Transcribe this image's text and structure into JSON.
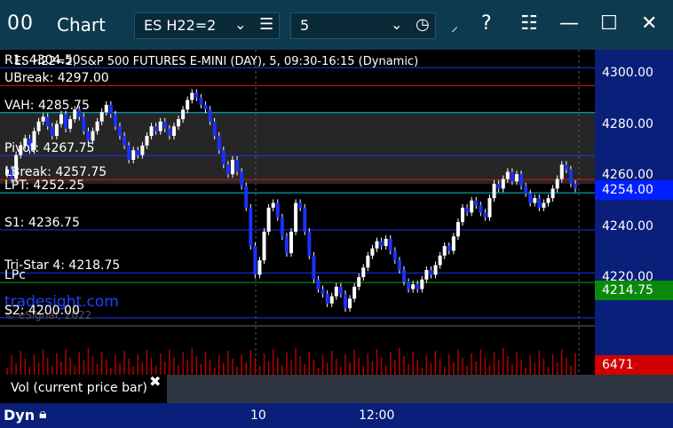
{
  "window": {
    "title": "Chart",
    "layout_icon": "00",
    "symbol": "ES H22=2",
    "interval": "5"
  },
  "chart": {
    "header": "ES H22=2, S&P 500 FUTURES E-MINI (DAY), 5, 09:30-16:15 (Dynamic)",
    "watermark": "tradesight.com",
    "copyright": "© eSignal, 2022",
    "levels": [
      {
        "label": "R1: 4304.50",
        "price": 4304.5,
        "color": "#2030ff"
      },
      {
        "label": "UBreak: 4297.00",
        "price": 4297.0,
        "color": "#e01010"
      },
      {
        "label": "VAH: 4285.75",
        "price": 4285.75,
        "color": "#00c8d8"
      },
      {
        "label": "Pivot: 4267.75",
        "price": 4267.75,
        "color": "#2030ff"
      },
      {
        "label": "LBreak: 4257.75",
        "price": 4257.75,
        "color": "#e01010"
      },
      {
        "label": "LPT: 4252.25",
        "price": 4252.25,
        "color": "#00c8d8"
      },
      {
        "label": "S1: 4236.75",
        "price": 4236.75,
        "color": "#2030ff"
      },
      {
        "label": "Tri-Star 4: 4218.75",
        "price": 4218.75,
        "color": "#2030ff"
      },
      {
        "label": "LPc",
        "price": 4214.75,
        "color": "#10a010"
      },
      {
        "label": "S2: 4200.00",
        "price": 4200.0,
        "color": "#2030ff"
      }
    ]
  },
  "axis": {
    "ticks": [
      "4300.00",
      "4280.00",
      "4260.00",
      "4240.00",
      "4220.00"
    ],
    "current_price": "4254.00",
    "lpc_price": "4214.75",
    "volume": "6471"
  },
  "vol_panel": {
    "label": "Vol (current price bar)"
  },
  "bottom": {
    "dyn": "Dyn",
    "x_labels": [
      "10",
      "12:00"
    ]
  },
  "chart_data": {
    "type": "candlestick",
    "ylim": [
      4197,
      4312
    ],
    "closes": [
      4262,
      4258,
      4268,
      4272,
      4275,
      4270,
      4278,
      4282,
      4284,
      4280,
      4276,
      4281,
      4285,
      4279,
      4283,
      4287,
      4284,
      4278,
      4274,
      4278,
      4282,
      4286,
      4289,
      4285,
      4280,
      4276,
      4272,
      4266,
      4270,
      4268,
      4272,
      4276,
      4280,
      4278,
      4282,
      4279,
      4276,
      4280,
      4283,
      4287,
      4291,
      4294,
      4292,
      4289,
      4287,
      4282,
      4276,
      4270,
      4264,
      4260,
      4266,
      4261,
      4255,
      4246,
      4230,
      4218,
      4224,
      4236,
      4246,
      4248,
      4242,
      4234,
      4227,
      4236,
      4248,
      4246,
      4236,
      4226,
      4216,
      4212,
      4210,
      4206,
      4209,
      4213,
      4210,
      4204,
      4208,
      4213,
      4217,
      4221,
      4226,
      4229,
      4232,
      4230,
      4233,
      4228,
      4224,
      4220,
      4215,
      4212,
      4214,
      4212,
      4216,
      4220,
      4218,
      4222,
      4226,
      4230,
      4228,
      4234,
      4240,
      4246,
      4244,
      4249,
      4247,
      4244,
      4242,
      4250,
      4256,
      4254,
      4258,
      4261,
      4257,
      4260,
      4255,
      4252,
      4248,
      4250,
      4246,
      4248,
      4250,
      4254,
      4258,
      4264,
      4262,
      4256,
      4254
    ]
  }
}
